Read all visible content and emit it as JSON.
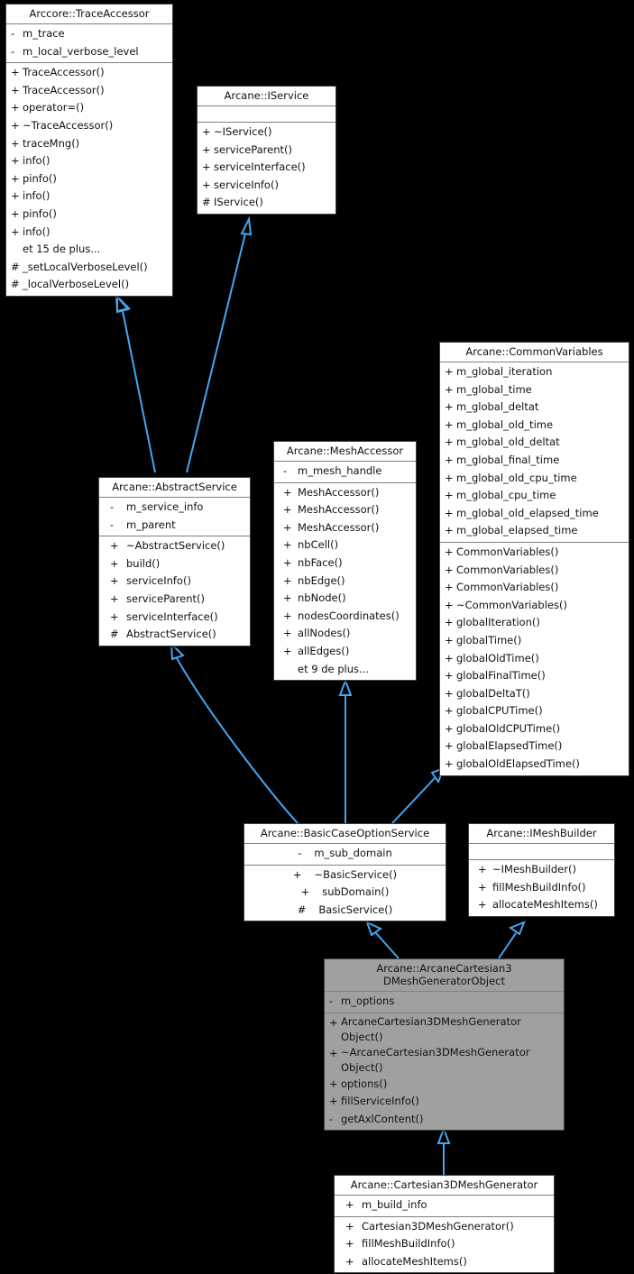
{
  "diagram": {
    "kind": "uml-inheritance-diagram",
    "background_color": "#000000",
    "edge_color": "#43a6f0",
    "box_fill": "#ffffff",
    "highlight_fill": "#a0a0a0",
    "more_label_fr": "et de plus..."
  },
  "classes": {
    "trace_accessor": {
      "title": "Arccore::TraceAccessor",
      "attributes": [
        {
          "vis": "-",
          "name": "m_trace"
        },
        {
          "vis": "-",
          "name": "m_local_verbose_level"
        }
      ],
      "methods": [
        {
          "vis": "+",
          "name": "TraceAccessor()"
        },
        {
          "vis": "+",
          "name": "TraceAccessor()"
        },
        {
          "vis": "+",
          "name": "operator=()"
        },
        {
          "vis": "+",
          "name": "~TraceAccessor()"
        },
        {
          "vis": "+",
          "name": "traceMng()"
        },
        {
          "vis": "+",
          "name": "info()"
        },
        {
          "vis": "+",
          "name": "pinfo()"
        },
        {
          "vis": "+",
          "name": "info()"
        },
        {
          "vis": "+",
          "name": "pinfo()"
        },
        {
          "vis": "+",
          "name": "info()"
        },
        {
          "vis": "",
          "name": "et 15 de plus..."
        },
        {
          "vis": "#",
          "name": "_setLocalVerboseLevel()"
        },
        {
          "vis": "#",
          "name": "_localVerboseLevel()"
        }
      ]
    },
    "iservice": {
      "title": "Arcane::IService",
      "attributes": [],
      "methods": [
        {
          "vis": "+",
          "name": "~IService()"
        },
        {
          "vis": "+",
          "name": "serviceParent()"
        },
        {
          "vis": "+",
          "name": "serviceInterface()"
        },
        {
          "vis": "+",
          "name": "serviceInfo()"
        },
        {
          "vis": "#",
          "name": "IService()"
        }
      ]
    },
    "common_variables": {
      "title": "Arcane::CommonVariables",
      "attributes": [
        {
          "vis": "+",
          "name": "m_global_iteration"
        },
        {
          "vis": "+",
          "name": "m_global_time"
        },
        {
          "vis": "+",
          "name": "m_global_deltat"
        },
        {
          "vis": "+",
          "name": "m_global_old_time"
        },
        {
          "vis": "+",
          "name": "m_global_old_deltat"
        },
        {
          "vis": "+",
          "name": "m_global_final_time"
        },
        {
          "vis": "+",
          "name": "m_global_old_cpu_time"
        },
        {
          "vis": "+",
          "name": "m_global_cpu_time"
        },
        {
          "vis": "+",
          "name": "m_global_old_elapsed_time"
        },
        {
          "vis": "+",
          "name": "m_global_elapsed_time"
        }
      ],
      "methods": [
        {
          "vis": "+",
          "name": "CommonVariables()"
        },
        {
          "vis": "+",
          "name": "CommonVariables()"
        },
        {
          "vis": "+",
          "name": "CommonVariables()"
        },
        {
          "vis": "+",
          "name": "~CommonVariables()"
        },
        {
          "vis": "+",
          "name": "globalIteration()"
        },
        {
          "vis": "+",
          "name": "globalTime()"
        },
        {
          "vis": "+",
          "name": "globalOldTime()"
        },
        {
          "vis": "+",
          "name": "globalFinalTime()"
        },
        {
          "vis": "+",
          "name": "globalDeltaT()"
        },
        {
          "vis": "+",
          "name": "globalCPUTime()"
        },
        {
          "vis": "+",
          "name": "globalOldCPUTime()"
        },
        {
          "vis": "+",
          "name": "globalElapsedTime()"
        },
        {
          "vis": "+",
          "name": "globalOldElapsedTime()"
        }
      ]
    },
    "abstract_service": {
      "title": "Arcane::AbstractService",
      "attributes": [
        {
          "vis": "-",
          "name": "m_service_info"
        },
        {
          "vis": "-",
          "name": "m_parent"
        }
      ],
      "methods": [
        {
          "vis": "+",
          "name": "~AbstractService()"
        },
        {
          "vis": "+",
          "name": "build()"
        },
        {
          "vis": "+",
          "name": "serviceInfo()"
        },
        {
          "vis": "+",
          "name": "serviceParent()"
        },
        {
          "vis": "+",
          "name": "serviceInterface()"
        },
        {
          "vis": "#",
          "name": "AbstractService()"
        }
      ]
    },
    "mesh_accessor": {
      "title": "Arcane::MeshAccessor",
      "attributes": [
        {
          "vis": "-",
          "name": "m_mesh_handle"
        }
      ],
      "methods": [
        {
          "vis": "+",
          "name": "MeshAccessor()"
        },
        {
          "vis": "+",
          "name": "MeshAccessor()"
        },
        {
          "vis": "+",
          "name": "MeshAccessor()"
        },
        {
          "vis": "+",
          "name": "nbCell()"
        },
        {
          "vis": "+",
          "name": "nbFace()"
        },
        {
          "vis": "+",
          "name": "nbEdge()"
        },
        {
          "vis": "+",
          "name": "nbNode()"
        },
        {
          "vis": "+",
          "name": "nodesCoordinates()"
        },
        {
          "vis": "+",
          "name": "allNodes()"
        },
        {
          "vis": "+",
          "name": "allEdges()"
        },
        {
          "vis": "",
          "name": "et 9 de plus..."
        }
      ]
    },
    "basic_case_option_service": {
      "title": "Arcane::BasicCaseOptionService",
      "attributes": [
        {
          "vis": "-",
          "name": "m_sub_domain"
        }
      ],
      "methods": [
        {
          "vis": "+",
          "name": "~BasicService()"
        },
        {
          "vis": "+",
          "name": "subDomain()"
        },
        {
          "vis": "#",
          "name": "BasicService()"
        }
      ]
    },
    "imesh_builder": {
      "title": "Arcane::IMeshBuilder",
      "attributes": [],
      "methods": [
        {
          "vis": "+",
          "name": "~IMeshBuilder()"
        },
        {
          "vis": "+",
          "name": "fillMeshBuildInfo()"
        },
        {
          "vis": "+",
          "name": "allocateMeshItems()"
        }
      ]
    },
    "generator_object": {
      "title": "Arcane::ArcaneCartesian3\nDMeshGeneratorObject",
      "highlighted": true,
      "attributes": [
        {
          "vis": "-",
          "name": "m_options"
        }
      ],
      "methods": [
        {
          "vis": "+",
          "name": "ArcaneCartesian3DMeshGenerator\nObject()"
        },
        {
          "vis": "+",
          "name": "~ArcaneCartesian3DMeshGenerator\nObject()"
        },
        {
          "vis": "+",
          "name": "options()"
        },
        {
          "vis": "+",
          "name": "fillServiceInfo()"
        },
        {
          "vis": "-",
          "name": "getAxlContent()"
        }
      ]
    },
    "cartesian_generator": {
      "title": "Arcane::Cartesian3DMeshGenerator",
      "attributes": [
        {
          "vis": "+",
          "name": "m_build_info"
        }
      ],
      "methods": [
        {
          "vis": "+",
          "name": "Cartesian3DMeshGenerator()"
        },
        {
          "vis": "+",
          "name": "fillMeshBuildInfo()"
        },
        {
          "vis": "+",
          "name": "allocateMeshItems()"
        }
      ]
    }
  },
  "inheritance_edges": [
    {
      "from": "abstract_service",
      "to": "trace_accessor"
    },
    {
      "from": "abstract_service",
      "to": "iservice"
    },
    {
      "from": "basic_case_option_service",
      "to": "abstract_service"
    },
    {
      "from": "basic_case_option_service",
      "to": "mesh_accessor"
    },
    {
      "from": "basic_case_option_service",
      "to": "common_variables"
    },
    {
      "from": "generator_object",
      "to": "basic_case_option_service"
    },
    {
      "from": "generator_object",
      "to": "imesh_builder"
    },
    {
      "from": "cartesian_generator",
      "to": "generator_object"
    }
  ]
}
